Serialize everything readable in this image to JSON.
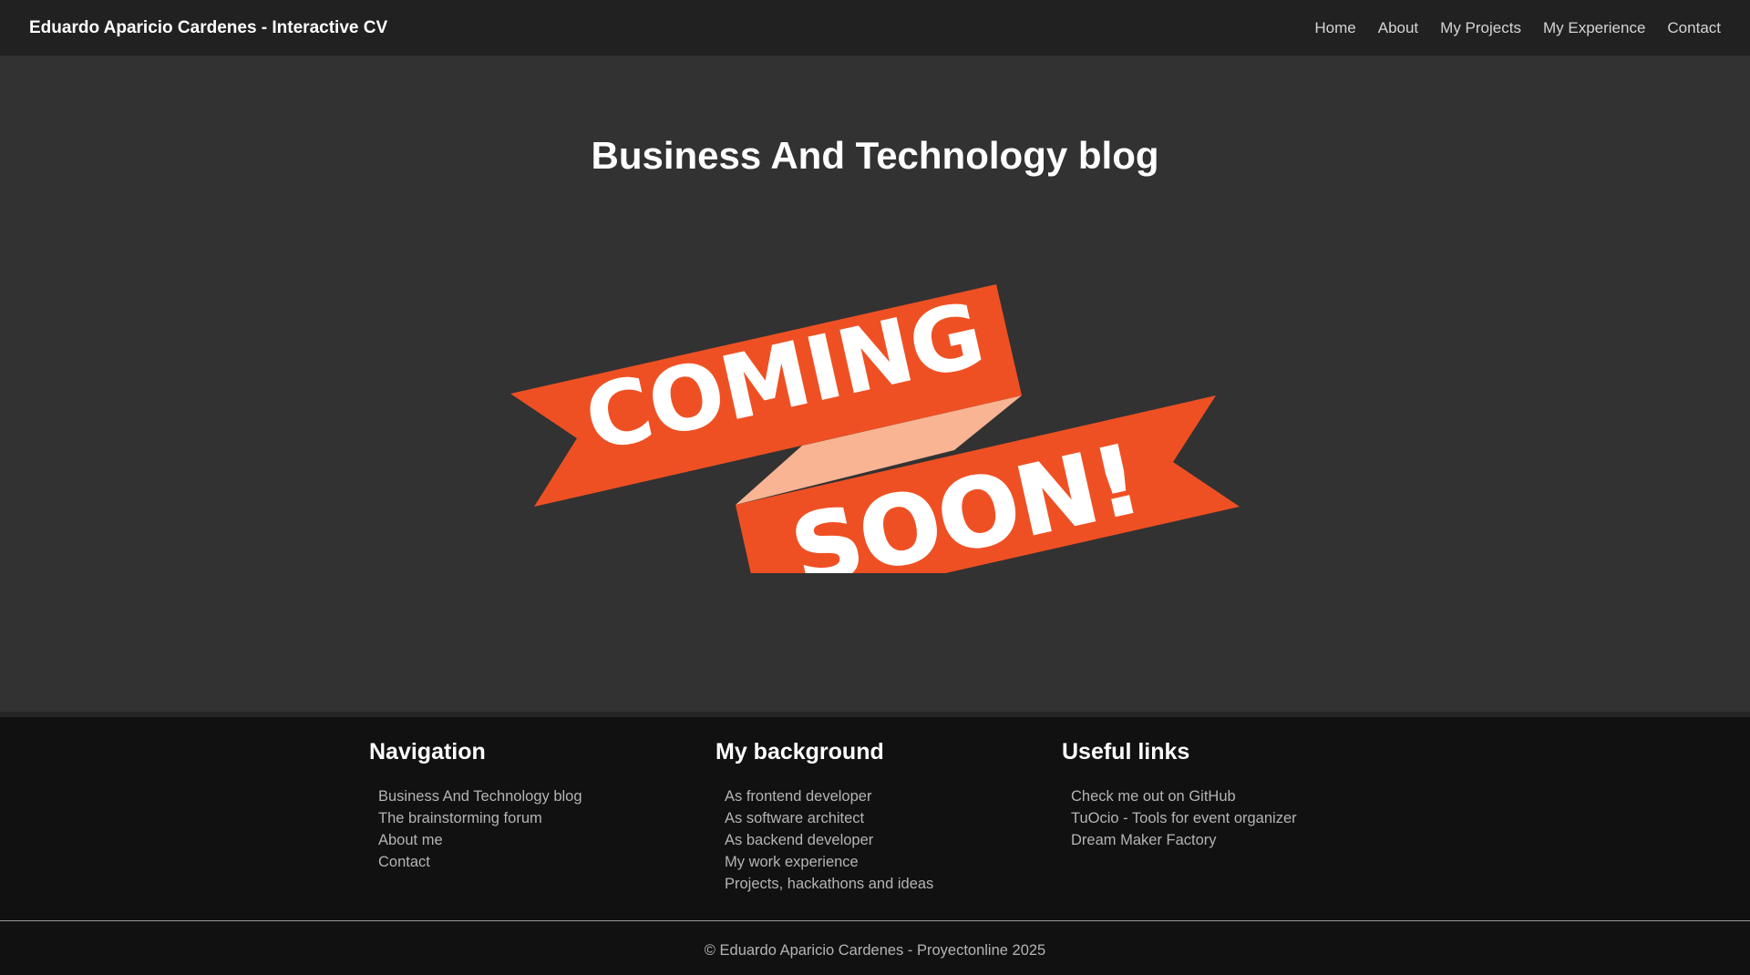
{
  "header": {
    "brand": "Eduardo Aparicio Cardenes - Interactive CV",
    "nav": [
      "Home",
      "About",
      "My Projects",
      "My Experience",
      "Contact"
    ]
  },
  "main": {
    "title": "Business And Technology blog",
    "banner": {
      "word1": "COMING",
      "word2": "SOON!",
      "ribbon_color": "#ef5023",
      "fold_color": "#f8b493"
    }
  },
  "footer": {
    "navigation": {
      "heading": "Navigation",
      "items": [
        "Business And Technology blog",
        "The brainstorming forum",
        "About me",
        "Contact"
      ]
    },
    "background": {
      "heading": "My background",
      "items": [
        "As frontend developer",
        "As software architect",
        "As backend developer",
        "My work experience",
        "Projects, hackathons and ideas"
      ]
    },
    "useful_links": {
      "heading": "Useful links",
      "items": [
        "Check me out on GitHub",
        "TuOcio - Tools for event organizer",
        "Dream Maker Factory"
      ]
    },
    "copyright": "© Eduardo Aparicio Cardenes - Proyectonline 2025"
  },
  "colors": {
    "navbar_bg": "#212121",
    "main_bg": "#323232",
    "footer_bg": "#111111"
  }
}
